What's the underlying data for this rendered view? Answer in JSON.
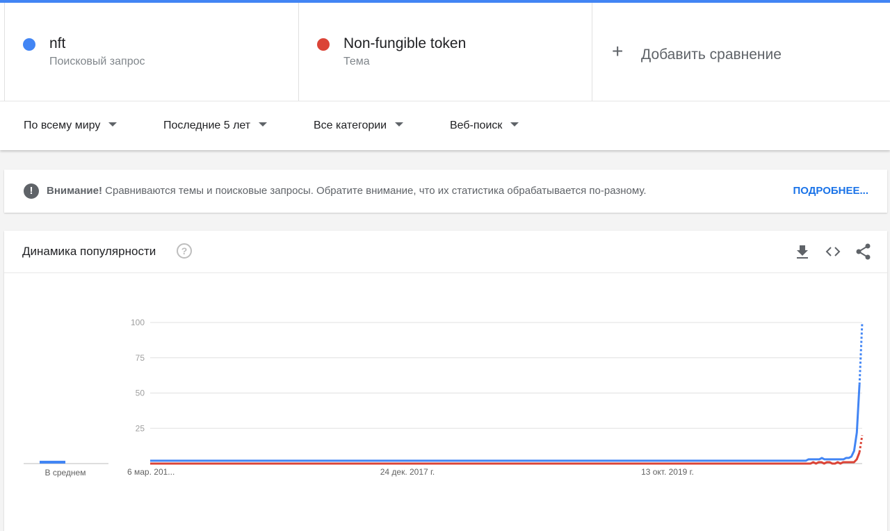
{
  "compare": {
    "terms": [
      {
        "name": "nft",
        "type": "Поисковый запрос",
        "color": "#4285f4"
      },
      {
        "name": "Non-fungible token",
        "type": "Тема",
        "color": "#db4437"
      }
    ],
    "add_label": "Добавить сравнение"
  },
  "filters": {
    "region": "По всему миру",
    "period": "Последние 5 лет",
    "category": "Все категории",
    "search_type": "Веб-поиск"
  },
  "notice": {
    "bold": "Внимание!",
    "text": " Сравниваются темы и поисковые запросы. Обратите внимание, что их статистика обрабатывается по-разному.",
    "more": "ПОДРОБНЕЕ..."
  },
  "card": {
    "title": "Динамика популярности",
    "help": "?"
  },
  "chart_data": {
    "type": "line",
    "ylim": [
      0,
      100
    ],
    "yticks": [
      100,
      75,
      50,
      25
    ],
    "x_labels": [
      "6 мар. 201...",
      "24 дек. 2017 г.",
      "13 окт. 2019 г."
    ],
    "average_label": "В среднем",
    "average": [
      {
        "series": "nft",
        "value": 2
      },
      {
        "series": "Non-fungible token",
        "value": 0
      }
    ],
    "partial_last_point": true,
    "series": [
      {
        "name": "nft",
        "color": "#4285f4",
        "values": [
          2,
          2,
          2,
          2,
          2,
          2,
          2,
          2,
          2,
          2,
          2,
          2,
          2,
          2,
          2,
          2,
          2,
          2,
          2,
          2,
          2,
          2,
          2,
          2,
          2,
          2,
          2,
          2,
          2,
          2,
          2,
          2,
          2,
          2,
          2,
          2,
          2,
          2,
          2,
          2,
          2,
          2,
          2,
          2,
          2,
          2,
          2,
          2,
          2,
          2,
          2,
          2,
          2,
          2,
          2,
          2,
          2,
          2,
          2,
          2,
          2,
          2,
          2,
          2,
          2,
          2,
          2,
          2,
          2,
          2,
          2,
          2,
          2,
          2,
          2,
          2,
          2,
          2,
          2,
          2,
          2,
          2,
          2,
          2,
          2,
          2,
          2,
          2,
          2,
          2,
          2,
          2,
          2,
          2,
          2,
          2,
          2,
          2,
          2,
          2,
          2,
          2,
          2,
          2,
          2,
          2,
          2,
          2,
          2,
          2,
          2,
          2,
          2,
          2,
          2,
          2,
          2,
          2,
          2,
          2,
          2,
          2,
          2,
          2,
          2,
          2,
          2,
          2,
          2,
          2,
          2,
          2,
          2,
          2,
          2,
          2,
          2,
          2,
          2,
          2,
          2,
          2,
          2,
          2,
          2,
          2,
          2,
          2,
          2,
          2,
          2,
          2,
          2,
          2,
          2,
          2,
          2,
          2,
          2,
          2,
          2,
          2,
          2,
          2,
          2,
          2,
          2,
          2,
          2,
          2,
          2,
          2,
          2,
          2,
          2,
          2,
          2,
          2,
          2,
          2,
          2,
          2,
          2,
          2,
          2,
          2,
          2,
          2,
          2,
          2,
          2,
          2,
          2,
          2,
          2,
          2,
          2,
          2,
          2,
          2,
          2,
          2,
          2,
          2,
          2,
          2,
          2,
          2,
          2,
          2,
          2,
          2,
          2,
          2,
          2,
          2,
          2,
          2,
          2,
          2,
          2,
          2,
          2,
          2,
          2,
          2,
          2,
          2,
          2,
          2,
          2,
          2,
          2,
          2,
          2,
          2,
          2,
          2,
          2,
          2,
          2,
          2,
          2,
          2,
          2,
          3,
          3,
          3,
          3,
          3,
          4,
          3,
          3,
          3,
          3,
          3,
          3,
          3,
          3,
          4,
          4,
          5,
          9,
          22,
          56,
          100
        ]
      },
      {
        "name": "Non-fungible token",
        "color": "#db4437",
        "values": [
          0,
          0,
          0,
          0,
          0,
          0,
          0,
          0,
          0,
          0,
          0,
          0,
          0,
          0,
          0,
          0,
          0,
          0,
          0,
          0,
          0,
          0,
          0,
          0,
          0,
          0,
          0,
          0,
          0,
          0,
          0,
          0,
          0,
          0,
          0,
          0,
          0,
          0,
          0,
          0,
          0,
          0,
          0,
          0,
          0,
          0,
          0,
          0,
          0,
          0,
          0,
          0,
          0,
          0,
          0,
          0,
          0,
          0,
          0,
          0,
          0,
          0,
          0,
          0,
          0,
          0,
          0,
          0,
          0,
          0,
          0,
          0,
          0,
          0,
          0,
          0,
          0,
          0,
          0,
          0,
          0,
          0,
          0,
          0,
          0,
          0,
          0,
          0,
          0,
          0,
          0,
          0,
          0,
          0,
          0,
          0,
          0,
          0,
          0,
          0,
          0,
          0,
          0,
          0,
          0,
          0,
          0,
          0,
          0,
          0,
          0,
          0,
          0,
          0,
          0,
          0,
          0,
          0,
          0,
          0,
          0,
          0,
          0,
          0,
          0,
          0,
          0,
          0,
          0,
          0,
          0,
          0,
          0,
          0,
          0,
          0,
          0,
          0,
          0,
          0,
          0,
          0,
          0,
          0,
          0,
          0,
          0,
          0,
          0,
          0,
          0,
          0,
          0,
          0,
          0,
          0,
          0,
          0,
          0,
          0,
          0,
          0,
          0,
          0,
          0,
          0,
          0,
          0,
          0,
          0,
          0,
          0,
          0,
          0,
          0,
          0,
          0,
          0,
          0,
          0,
          0,
          0,
          0,
          0,
          0,
          0,
          0,
          0,
          0,
          0,
          0,
          0,
          0,
          0,
          0,
          0,
          0,
          0,
          0,
          0,
          0,
          0,
          0,
          0,
          0,
          0,
          0,
          0,
          0,
          0,
          0,
          0,
          0,
          0,
          0,
          0,
          0,
          0,
          0,
          0,
          0,
          0,
          0,
          0,
          0,
          0,
          0,
          0,
          0,
          0,
          0,
          0,
          0,
          0,
          0,
          0,
          0,
          0,
          0,
          0,
          0,
          0,
          0,
          0,
          1,
          0,
          1,
          1,
          0,
          1,
          1,
          0,
          0,
          1,
          0,
          1,
          1,
          1,
          1,
          1,
          3,
          8,
          20
        ]
      }
    ]
  }
}
